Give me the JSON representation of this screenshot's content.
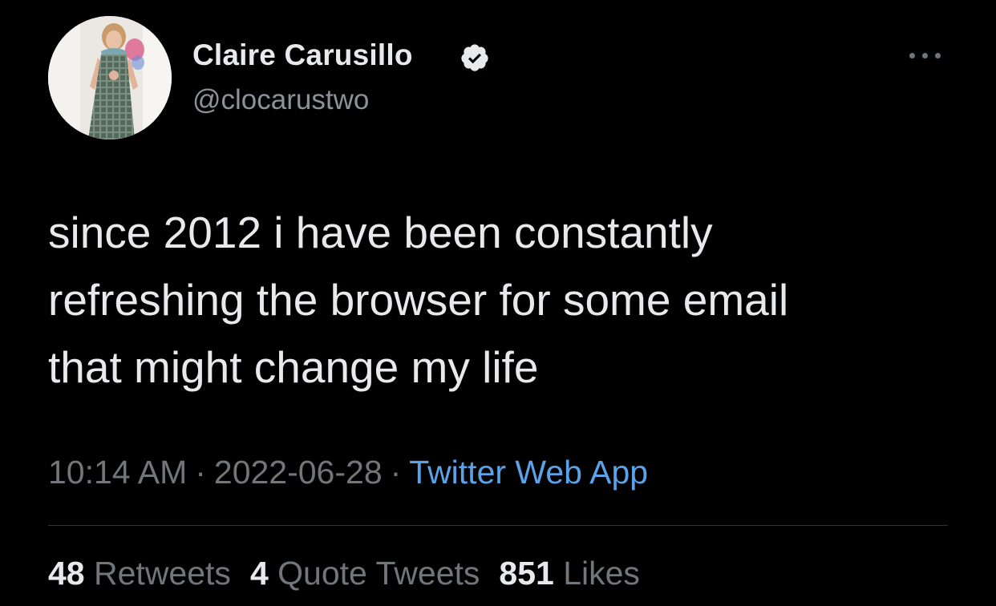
{
  "author": {
    "display_name": "Claire Carusillo",
    "handle": "@clocarustwo",
    "verified_icon": "verified-badge-icon",
    "avatar_icon": "profile-photo"
  },
  "more_menu_icon": "more-dots-icon",
  "tweet": {
    "lines": [
      "since 2012 i have been constantly",
      "refreshing the browser for some email",
      "that might change my life"
    ]
  },
  "meta": {
    "time": "10:14 AM",
    "separator": "·",
    "date": "2022-06-28",
    "source": "Twitter Web App"
  },
  "stats": {
    "retweets_count": "48",
    "retweets_label": "Retweets",
    "quotes_count": "4",
    "quotes_label": "Quote Tweets",
    "likes_count": "851",
    "likes_label": "Likes"
  },
  "colors": {
    "background": "#000000",
    "primary_text": "#e7e9ea",
    "secondary_text": "#71767b",
    "link": "#5aa3e8",
    "divider": "#2f3336"
  }
}
